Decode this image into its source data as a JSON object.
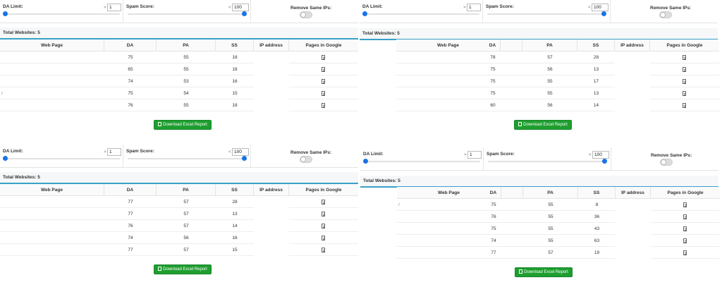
{
  "panels": [
    {
      "da_limit_label": "DA Limit:",
      "da_cmp": ">",
      "da_value": "1",
      "spam_label": "Spam Score:",
      "spam_cmp": "<",
      "spam_value": "100",
      "ips_label": "Remove Same IPs:",
      "total_label": "Total Websites: 5",
      "headers": {
        "web": "Web Page",
        "da": "DA",
        "pa": "PA",
        "ss": "SS",
        "ip": "IP address",
        "pages": "Pages in Google"
      },
      "rows": [
        {
          "web": "",
          "da": "75",
          "pa": "55",
          "ss": "18"
        },
        {
          "web": "",
          "da": "65",
          "pa": "55",
          "ss": "18"
        },
        {
          "web": "",
          "da": "74",
          "pa": "53",
          "ss": "16"
        },
        {
          "web": "/",
          "da": "75",
          "pa": "54",
          "ss": "15"
        },
        {
          "web": "",
          "da": "76",
          "pa": "55",
          "ss": "18"
        }
      ],
      "download_label": "Download Excel Report"
    },
    {
      "da_limit_label": "DA Limit:",
      "da_cmp": ">",
      "da_value": "1",
      "spam_label": "Spam Score:",
      "spam_cmp": "<",
      "spam_value": "100",
      "ips_label": "Remove Same IPs:",
      "total_label": "Total Websites: 5",
      "headers": {
        "web": "Web Page",
        "da": "DA",
        "pa": "PA",
        "ss": "SS",
        "ip": "IP address",
        "pages": "Pages in Google"
      },
      "rows": [
        {
          "web": "",
          "da": "78",
          "pa": "57",
          "ss": "28"
        },
        {
          "web": "",
          "da": "75",
          "pa": "56",
          "ss": "13"
        },
        {
          "web": "",
          "da": "75",
          "pa": "55",
          "ss": "17"
        },
        {
          "web": "",
          "da": "75",
          "pa": "55",
          "ss": "13"
        },
        {
          "web": "",
          "da": "60",
          "pa": "56",
          "ss": "14"
        }
      ],
      "download_label": "Download Excel Report"
    },
    {
      "da_limit_label": "DA Limit:",
      "da_cmp": ">",
      "da_value": "1",
      "spam_label": "Spam Score:",
      "spam_cmp": "<",
      "spam_value": "100",
      "ips_label": "Remove Same IPs:",
      "total_label": "Total Websites: 5",
      "headers": {
        "web": "Web Page",
        "da": "DA",
        "pa": "PA",
        "ss": "SS",
        "ip": "IP address",
        "pages": "Pages in Google"
      },
      "rows": [
        {
          "web": "",
          "da": "77",
          "pa": "57",
          "ss": "28"
        },
        {
          "web": "",
          "da": "77",
          "pa": "57",
          "ss": "13"
        },
        {
          "web": "",
          "da": "76",
          "pa": "57",
          "ss": "14"
        },
        {
          "web": "",
          "da": "74",
          "pa": "56",
          "ss": "16"
        },
        {
          "web": "",
          "da": "77",
          "pa": "57",
          "ss": "15"
        }
      ],
      "download_label": "Download Excel Report"
    },
    {
      "da_limit_label": "DA Limit:",
      "da_cmp": ">",
      "da_value": "1",
      "spam_label": "Spam Score:",
      "spam_cmp": "<",
      "spam_value": "100",
      "ips_label": "Remove Same IPs:",
      "total_label": "Total Websites: 5",
      "headers": {
        "web": "Web Page",
        "da": "DA",
        "pa": "PA",
        "ss": "SS",
        "ip": "IP address",
        "pages": "Pages in Google"
      },
      "rows": [
        {
          "web": "/",
          "da": "75",
          "pa": "55",
          "ss": "8"
        },
        {
          "web": "",
          "da": "76",
          "pa": "55",
          "ss": "36"
        },
        {
          "web": "",
          "da": "75",
          "pa": "55",
          "ss": "43"
        },
        {
          "web": "",
          "da": "74",
          "pa": "55",
          "ss": "63"
        },
        {
          "web": "",
          "da": "77",
          "pa": "57",
          "ss": "19"
        }
      ],
      "download_label": "Download Excel Report"
    }
  ],
  "colors": {
    "accent": "#1a73e8",
    "rule": "#3aa0c8",
    "button": "#1e9e2f"
  }
}
